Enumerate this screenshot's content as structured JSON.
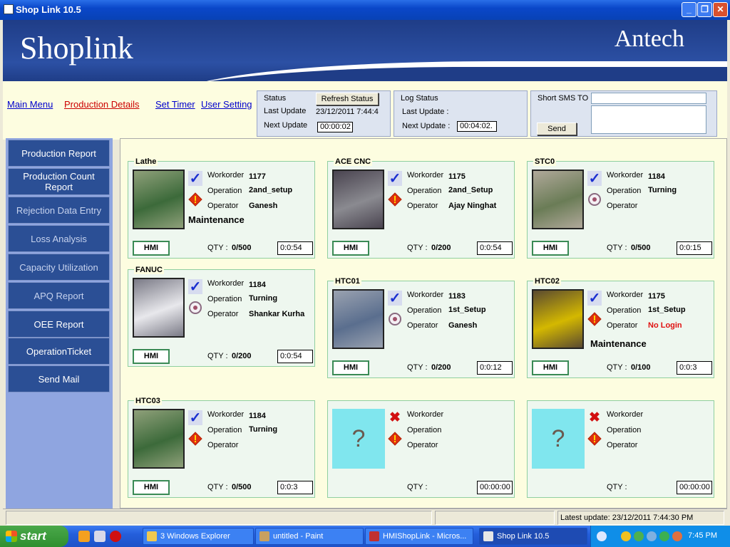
{
  "window": {
    "title": "Shop Link 10.5",
    "minimize": "_",
    "maximize": "❐",
    "close": "✕"
  },
  "banner": {
    "brand": "Shoplink",
    "company": "Antech"
  },
  "nav": {
    "main_menu": "Main Menu",
    "production_details": "Production Details",
    "set_timer": "Set Timer",
    "user_setting": "User Setting"
  },
  "status": {
    "status_label": "Status",
    "refresh": "Refresh Status",
    "last_update_label": "Last Update",
    "last_update": "23/12/2011 7:44:4",
    "next_update_label": "Next Update",
    "next_update": "00:00:02"
  },
  "log": {
    "label": "Log Status",
    "last_update_label": "Last Update :",
    "next_update_label": "Next Update :",
    "next_update": "00:04:02."
  },
  "sms": {
    "label": "Short SMS TO",
    "send": "Send"
  },
  "sidebar": [
    "Production Report",
    "Production Count Report",
    "Rejection Data Entry",
    "Loss Analysis",
    "Capacity Utilization",
    "APQ Report",
    "OEE Report",
    "OperationTicket",
    "Send Mail"
  ],
  "labels": {
    "workorder": "Workorder",
    "operation": "Operation",
    "operator": "Operator",
    "qty": "QTY :",
    "hmi": "HMI"
  },
  "machines": [
    {
      "name": "Lathe",
      "workorder": "1177",
      "operation": "2and_setup",
      "operator": "Ganesh",
      "status": "Maintenance",
      "qty": "0/500",
      "timer": "0:0:54"
    },
    {
      "name": "ACE CNC",
      "workorder": "1175",
      "operation": "2and_Setup",
      "operator": "Ajay Ninghat",
      "status": "",
      "qty": "0/200",
      "timer": "0:0:54"
    },
    {
      "name": "STC0",
      "workorder": "1184",
      "operation": "Turning",
      "operator": "",
      "status": "",
      "qty": "0/500",
      "timer": "0:0:15"
    },
    {
      "name": "FANUC",
      "workorder": "1184",
      "operation": "Turning",
      "operator": "Shankar Kurha",
      "status": "",
      "qty": "0/200",
      "timer": "0:0:54"
    },
    {
      "name": "HTC01",
      "workorder": "1183",
      "operation": "1st_Setup",
      "operator": "Ganesh",
      "status": "",
      "qty": "0/200",
      "timer": "0:0:12"
    },
    {
      "name": "HTC02",
      "workorder": "1175",
      "operation": "1st_Setup",
      "operator": "No Login",
      "status": "Maintenance",
      "qty": "0/100",
      "timer": "0:0:3"
    },
    {
      "name": "HTC03",
      "workorder": "1184",
      "operation": "Turning",
      "operator": "",
      "status": "",
      "qty": "0/500",
      "timer": "0:0:3"
    },
    {
      "name": "",
      "workorder": "",
      "operation": "",
      "operator": "",
      "status": "",
      "qty": "",
      "timer": "00:00:00",
      "unknown": "?"
    },
    {
      "name": "",
      "workorder": "",
      "operation": "",
      "operator": "",
      "status": "",
      "qty": "",
      "timer": "00:00:00",
      "unknown": "?"
    }
  ],
  "statusbar": {
    "latest_update": "Latest update: 23/12/2011 7:44:30 PM"
  },
  "taskbar": {
    "start": "start",
    "tasks": [
      "3 Windows Explorer",
      "untitled - Paint",
      "HMIShopLink - Micros...",
      "Shop Link 10.5"
    ],
    "clock": "7:45 PM"
  },
  "colors": {
    "banner": "#2c50a4",
    "sidebar_item": "#2b4f95",
    "card_bg": "#eef7ef",
    "warn": "#e01010",
    "check": "#1a2fd0"
  },
  "icons": [
    "check-icon",
    "warning-icon",
    "idle-icon",
    "error-x-icon",
    "unknown-machine-icon"
  ]
}
